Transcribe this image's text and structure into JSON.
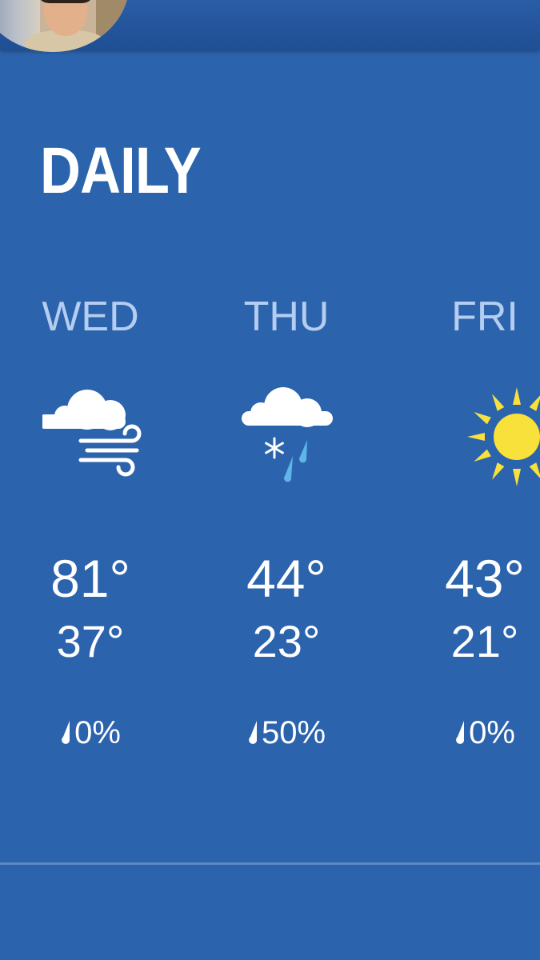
{
  "header": {
    "avatar_icon": "user-avatar"
  },
  "section": {
    "title": "DAILY"
  },
  "days": [
    {
      "name": "WED",
      "icon": "cloud-wind-icon",
      "high": "81°",
      "low": "37°",
      "precip": "0%"
    },
    {
      "name": "THU",
      "icon": "cloud-snow-rain-icon",
      "high": "44°",
      "low": "23°",
      "precip": "50%"
    },
    {
      "name": "FRI",
      "icon": "sun-icon",
      "high": "43°",
      "low": "21°",
      "precip": "0%"
    }
  ],
  "colors": {
    "background": "#2c63ad",
    "day_label": "#b4cdf0",
    "sun": "#f7e13a",
    "rain": "#5fb4e8"
  }
}
